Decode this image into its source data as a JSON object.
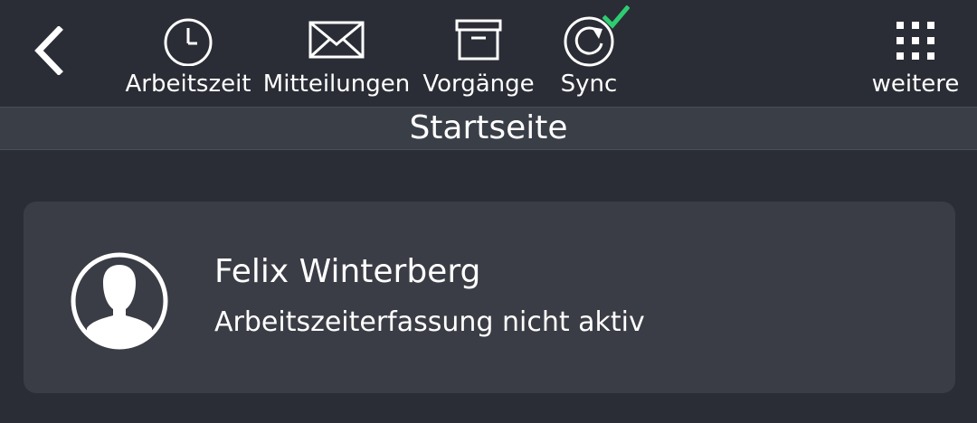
{
  "toolbar": {
    "back_icon": "chevron-left-icon",
    "items": [
      {
        "id": "arbeitszeit",
        "label": "Arbeitszeit",
        "icon": "clock-icon"
      },
      {
        "id": "mitteilungen",
        "label": "Mitteilungen",
        "icon": "envelope-icon"
      },
      {
        "id": "vorgaenge",
        "label": "Vorgänge",
        "icon": "archive-box-icon"
      },
      {
        "id": "sync",
        "label": "Sync",
        "icon": "sync-icon",
        "status_icon": "checkmark-icon",
        "status_color": "#2ecc71"
      },
      {
        "id": "weitere",
        "label": "weitere",
        "icon": "grid-dots-icon"
      }
    ]
  },
  "page": {
    "title": "Startseite"
  },
  "user_card": {
    "name": "Felix Winterberg",
    "status": "Arbeitszeiterfassung nicht aktiv",
    "avatar_icon": "user-avatar-icon"
  },
  "colors": {
    "background": "#2a2d35",
    "title_bar": "#3a3e47",
    "card": "#3a3d45",
    "text": "#ffffff",
    "accent_check": "#2ecc71"
  }
}
